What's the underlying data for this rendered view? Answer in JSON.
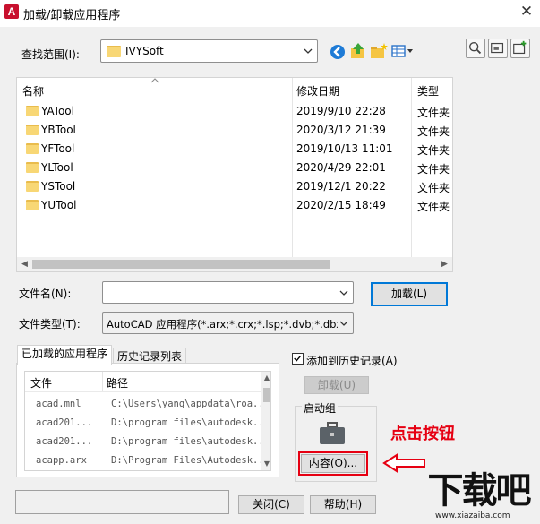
{
  "window": {
    "title": "加载/卸载应用程序",
    "app_icon": "A",
    "close": "✕"
  },
  "lookin": {
    "label": "查找范围(I):",
    "value": "IVYSoft"
  },
  "filelist": {
    "headers": [
      "名称",
      "修改日期",
      "类型"
    ],
    "rows": [
      {
        "name": "YATool",
        "date": "2019/9/10 22:28",
        "type": "文件夹"
      },
      {
        "name": "YBTool",
        "date": "2020/3/12 21:39",
        "type": "文件夹"
      },
      {
        "name": "YFTool",
        "date": "2019/10/13 11:01",
        "type": "文件夹"
      },
      {
        "name": "YLTool",
        "date": "2020/4/29 22:01",
        "type": "文件夹"
      },
      {
        "name": "YSTool",
        "date": "2019/12/1 20:22",
        "type": "文件夹"
      },
      {
        "name": "YUTool",
        "date": "2020/2/15 18:49",
        "type": "文件夹"
      }
    ]
  },
  "filename": {
    "label": "文件名(N):",
    "value": "",
    "load_button": "加载(L)"
  },
  "filetype": {
    "label": "文件类型(T):",
    "value": "AutoCAD 应用程序(*.arx;*.crx;*.lsp;*.dvb;*.dbx"
  },
  "tabs": {
    "loaded": "已加载的应用程序",
    "history": "历史记录列表"
  },
  "loaded_list": {
    "headers": [
      "文件",
      "路径"
    ],
    "rows": [
      {
        "file": "acad.mnl",
        "path": "C:\\Users\\yang\\appdata\\roa..."
      },
      {
        "file": "acad201...",
        "path": "D:\\program files\\autodesk..."
      },
      {
        "file": "acad201...",
        "path": "D:\\program files\\autodesk..."
      },
      {
        "file": "acapp.arx",
        "path": "D:\\Program Files\\Autodesk..."
      }
    ]
  },
  "history_checkbox": "添加到历史记录(A)",
  "unload_button": "卸载(U)",
  "startup": {
    "group_label": "启动组",
    "contents_button": "内容(O)..."
  },
  "annotation": "点击按钮",
  "bottom": {
    "close_button": "关闭(C)",
    "help_button": "帮助(H)"
  },
  "watermark": {
    "brand": "下载吧",
    "url": "www.xiazaiba.com"
  }
}
